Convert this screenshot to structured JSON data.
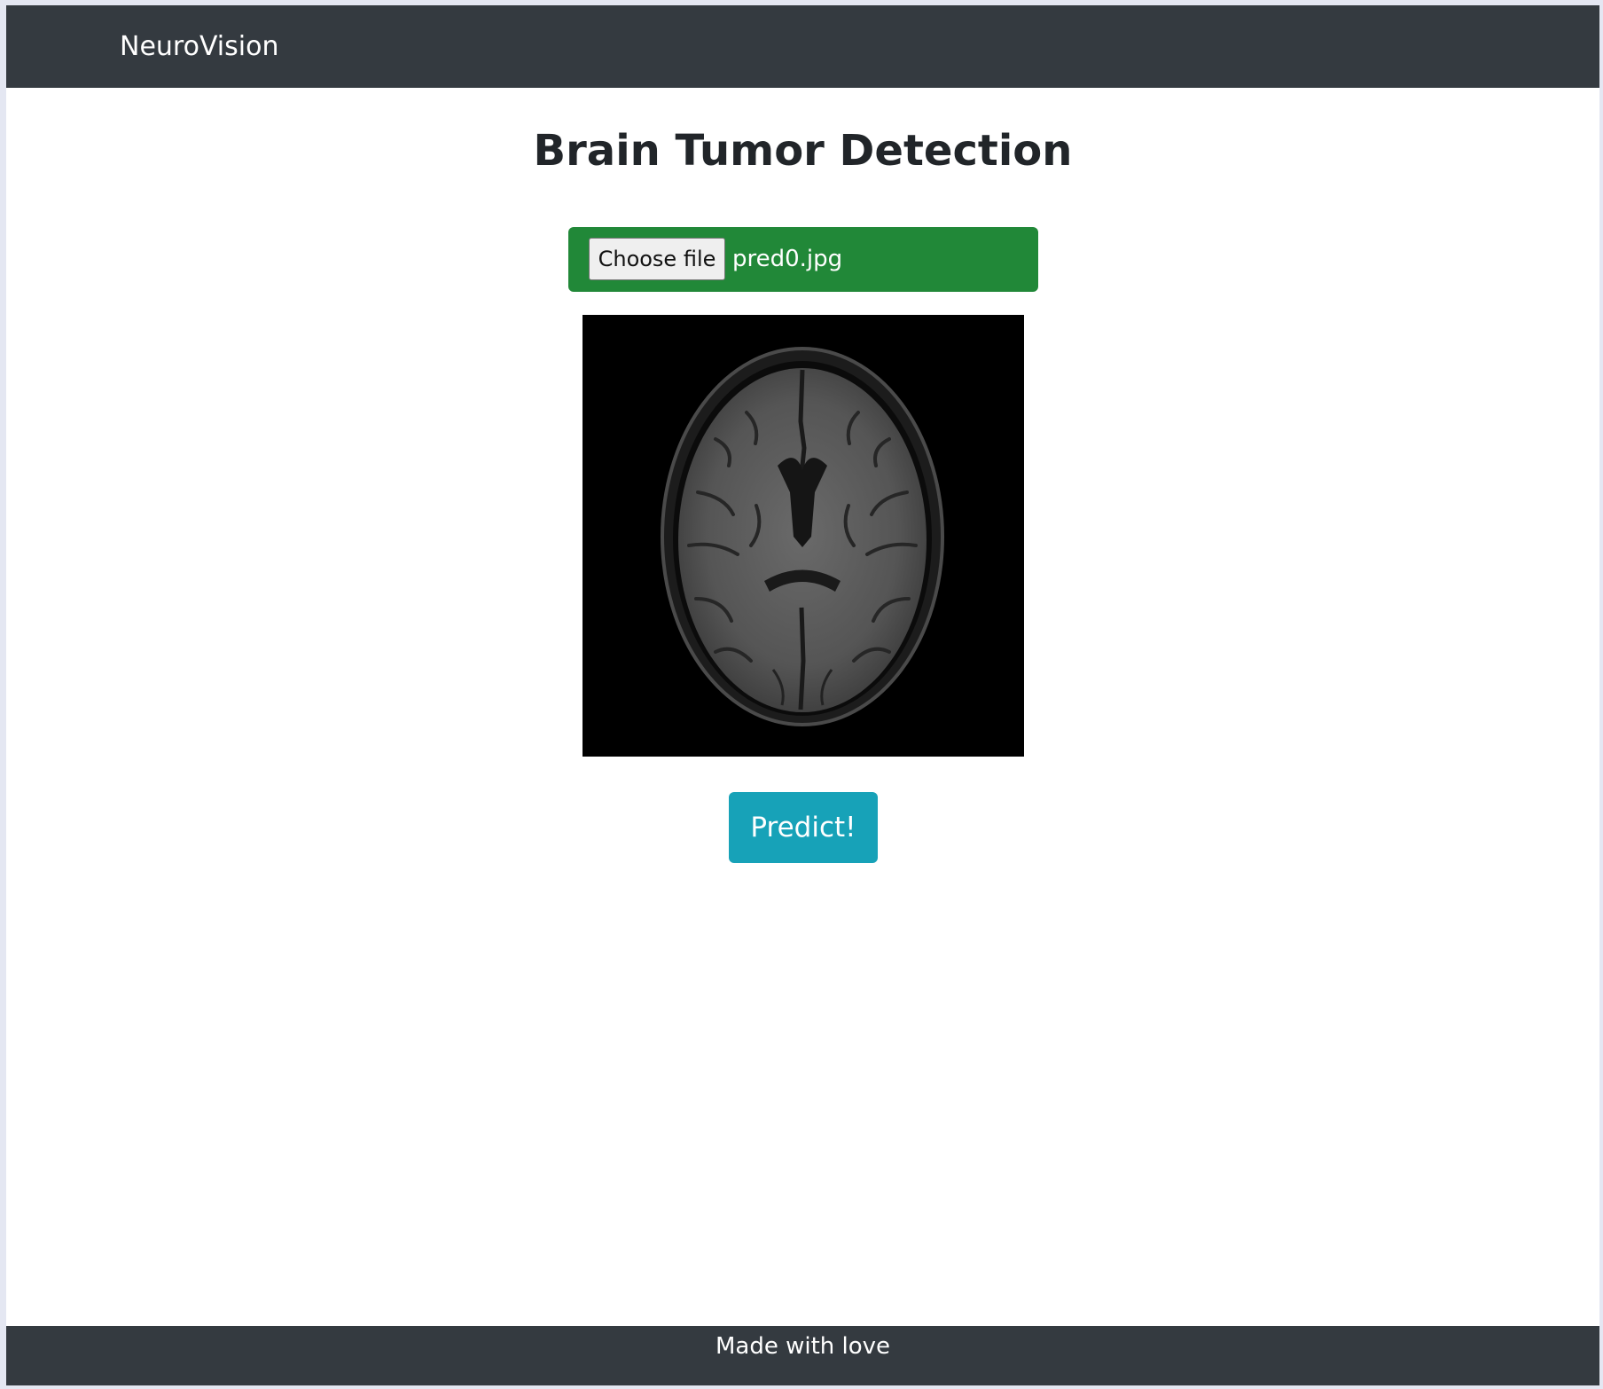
{
  "navbar": {
    "brand": "NeuroVision"
  },
  "main": {
    "title": "Brain Tumor Detection",
    "file_input": {
      "button_label": "Choose file",
      "file_name": "pred0.jpg"
    },
    "predict_label": "Predict!"
  },
  "footer": {
    "text": "Made with love"
  },
  "colors": {
    "navbar": "#343a40",
    "file_bar": "#218838",
    "predict_button": "#17a2b8",
    "page_background": "#ffffff"
  }
}
